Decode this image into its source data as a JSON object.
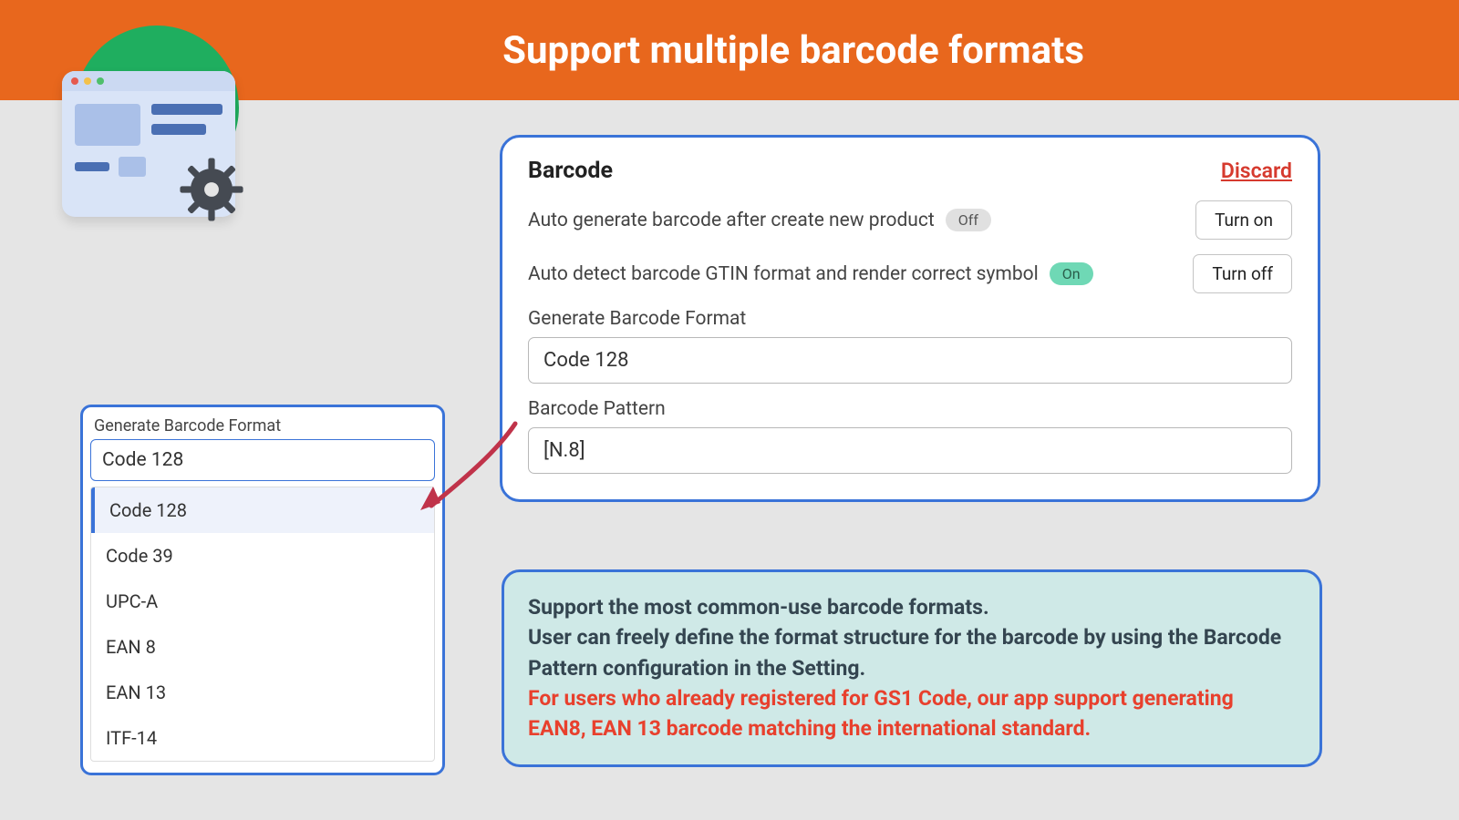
{
  "banner": {
    "title": "Support multiple barcode formats"
  },
  "card": {
    "title": "Barcode",
    "discard": "Discard",
    "row1": {
      "label": "Auto generate barcode after create new product",
      "pill": "Off",
      "btn": "Turn on"
    },
    "row2": {
      "label": "Auto detect barcode GTIN format and render correct symbol",
      "pill": "On",
      "btn": "Turn off"
    },
    "format_label": "Generate Barcode Format",
    "format_value": "Code 128",
    "pattern_label": "Barcode Pattern",
    "pattern_value": "[N.8]"
  },
  "dropdown": {
    "label": "Generate Barcode Format",
    "selected": "Code 128",
    "options": [
      "Code 128",
      "Code 39",
      "UPC-A",
      "EAN 8",
      "EAN 13",
      "ITF-14"
    ]
  },
  "info": {
    "line1": "Support the most common-use barcode formats.",
    "line2": "User can freely define the format structure for the barcode by using the Barcode Pattern configuration in the Setting.",
    "line3": "For users who already registered for GS1 Code, our app support generating EAN8, EAN 13 barcode matching the international standard."
  }
}
